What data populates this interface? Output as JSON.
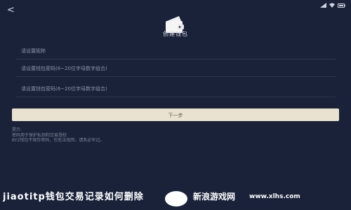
{
  "status_bar": {
    "time": ""
  },
  "header": {
    "back_glyph": "<",
    "title": "创建钱包"
  },
  "form": {
    "name_placeholder": "请设置昵称",
    "password_placeholder": "请设置钱包密码(6~20位字母数字组合)",
    "confirm_placeholder": "请设置钱包密码(6~20位字母数字组合)"
  },
  "actions": {
    "next_label": "下一步"
  },
  "notice": {
    "lines": [
      "提示:",
      "密码用于保护私钥和交易授权",
      "BY2钱包不保存密码，也无法找回，请务必牢记。"
    ]
  },
  "watermark": {
    "text": "jiaotitp钱包交易记录如何删除",
    "site_name": "新浪游戏网",
    "site_url": "www.xlhs.com"
  },
  "colors": {
    "background": "#1a2239",
    "button": "#e9e2cf"
  }
}
